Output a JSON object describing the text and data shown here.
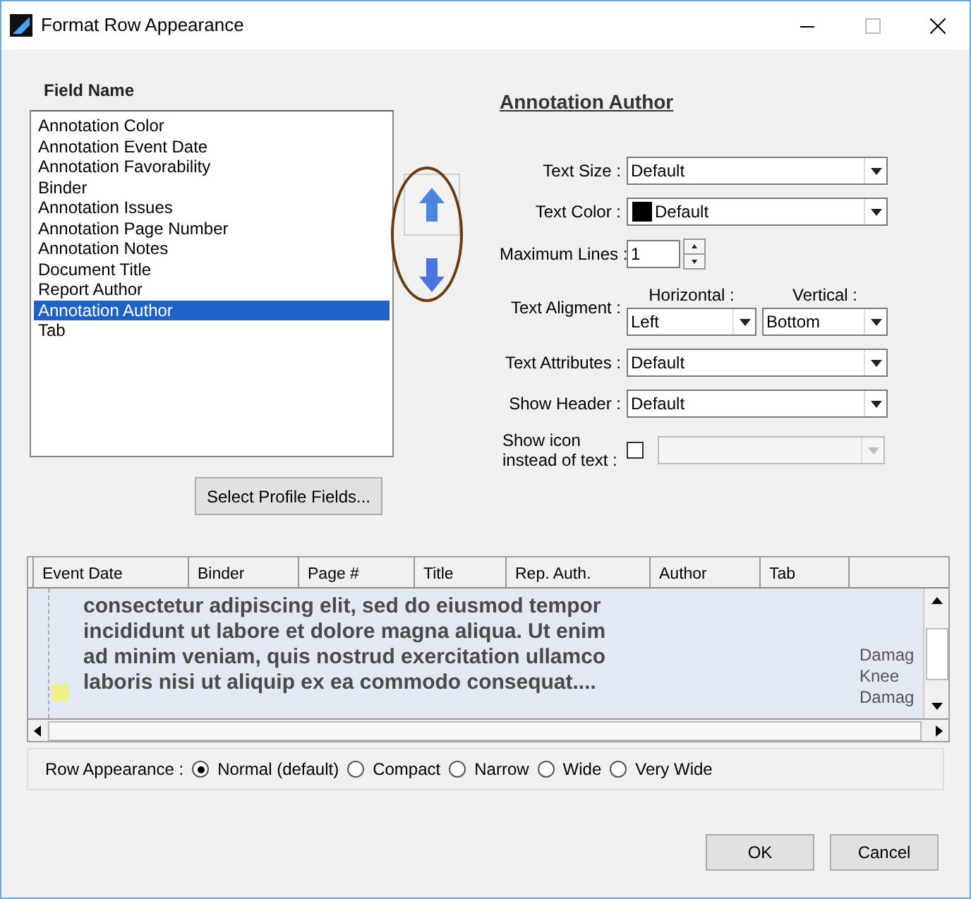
{
  "window": {
    "title": "Format Row Appearance"
  },
  "field_list": {
    "heading": "Field Name",
    "items": [
      {
        "label": "Annotation Color",
        "selected": false
      },
      {
        "label": "Annotation Event Date",
        "selected": false
      },
      {
        "label": "Annotation Favorability",
        "selected": false
      },
      {
        "label": "Binder",
        "selected": false
      },
      {
        "label": "Annotation Issues",
        "selected": false
      },
      {
        "label": "Annotation Page Number",
        "selected": false
      },
      {
        "label": "Annotation Notes",
        "selected": false
      },
      {
        "label": "Document Title",
        "selected": false
      },
      {
        "label": "Report Author",
        "selected": false
      },
      {
        "label": "Annotation Author",
        "selected": true
      },
      {
        "label": "Tab",
        "selected": false
      }
    ]
  },
  "select_profile_button": "Select Profile Fields...",
  "details": {
    "heading": "Annotation Author",
    "settings": [
      {
        "kind": "select",
        "label": "Text Size :",
        "value": "Default"
      },
      {
        "kind": "color",
        "label": "Text Color :",
        "value": "Default",
        "color": "#000000"
      },
      {
        "kind": "spinner",
        "label": "Maximum Lines :",
        "value": "1"
      },
      {
        "kind": "alignment",
        "label": "Text Aligment :",
        "horizontal_label": "Horizontal :",
        "horizontal_value": "Left",
        "vertical_label": "Vertical :",
        "vertical_value": "Bottom"
      },
      {
        "kind": "select",
        "label": "Text Attributes :",
        "value": "Default"
      },
      {
        "kind": "select",
        "label": "Show Header :",
        "value": "Default"
      },
      {
        "kind": "icon",
        "label": "Show icon instead of text :",
        "checked": false,
        "disabled": true
      }
    ]
  },
  "grid": {
    "columns": [
      "Event Date",
      "Binder",
      "Page #",
      "Title",
      "Rep. Auth.",
      "Author",
      "Tab"
    ],
    "preview_lines": [
      "consectetur adipiscing elit, sed do eiusmod tempor",
      "incididunt ut labore et dolore magna aliqua. Ut enim",
      "ad minim veniam, quis nostrud exercitation ullamco",
      "laboris nisi ut aliquip ex ea commodo consequat...."
    ],
    "side_lines": [
      "Damag",
      "Knee",
      "Damag"
    ]
  },
  "row_appearance": {
    "label": "Row Appearance :",
    "options": [
      {
        "label": "Normal (default)",
        "selected": true
      },
      {
        "label": "Compact",
        "selected": false
      },
      {
        "label": "Narrow",
        "selected": false
      },
      {
        "label": "Wide",
        "selected": false
      },
      {
        "label": "Very Wide",
        "selected": false
      }
    ]
  },
  "buttons": [
    "OK",
    "Cancel"
  ]
}
